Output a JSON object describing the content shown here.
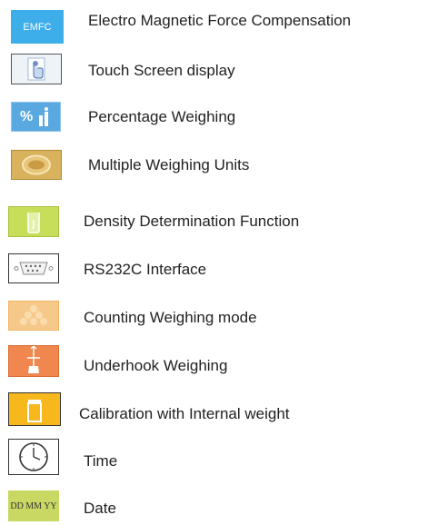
{
  "features": [
    {
      "icon": "emfc-icon",
      "icon_text": "EMFC",
      "label": "Electro Magnetic Force Compensation",
      "color": "#3daee9"
    },
    {
      "icon": "touch-hand-icon",
      "label": "Touch Screen display",
      "color": "#d8e6f3"
    },
    {
      "icon": "percentage-icon",
      "icon_text": "%",
      "label": "Percentage Weighing",
      "color": "#5aa8e0"
    },
    {
      "icon": "weighing-units-icon",
      "label": "Multiple Weighing Units",
      "color": "#d4aa55"
    },
    {
      "icon": "density-beaker-icon",
      "label": "Density Determination Function",
      "color": "#c6de5a"
    },
    {
      "icon": "rs232c-connector-icon",
      "label": "RS232C Interface",
      "color": "#ffffff"
    },
    {
      "icon": "counting-icon",
      "label": "Counting Weighing mode",
      "color": "#f6c98a"
    },
    {
      "icon": "underhook-icon",
      "label": "Underhook Weighing",
      "color": "#f0874e"
    },
    {
      "icon": "internal-weight-icon",
      "label": "Calibration with Internal weight",
      "color": "#f7b81e"
    },
    {
      "icon": "clock-icon",
      "label": "Time",
      "color": "#ffffff"
    },
    {
      "icon": "date-icon",
      "icon_text": "DD MM YY",
      "label": "Date",
      "color": "#c8d862"
    }
  ]
}
